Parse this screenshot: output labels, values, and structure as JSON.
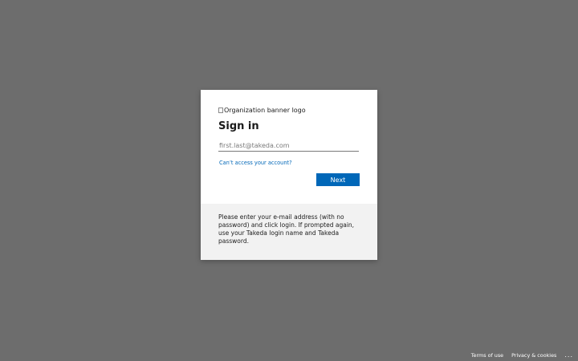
{
  "signin": {
    "logo_alt": "Organization banner logo",
    "title": "Sign in",
    "email_placeholder": "first.last@takeda.com",
    "email_value": "",
    "cant_access_link": "Can’t access your account?",
    "next_button": "Next",
    "description": "Please enter your e-mail address (with no password) and click login. If prompted again, use your Takeda login name and Takeda password."
  },
  "footer": {
    "terms": "Terms of use",
    "privacy": "Privacy & cookies",
    "more": "..."
  },
  "colors": {
    "backdrop": "#6d6d6d",
    "accent": "#0067b8",
    "info_panel": "#f2f2f2"
  }
}
